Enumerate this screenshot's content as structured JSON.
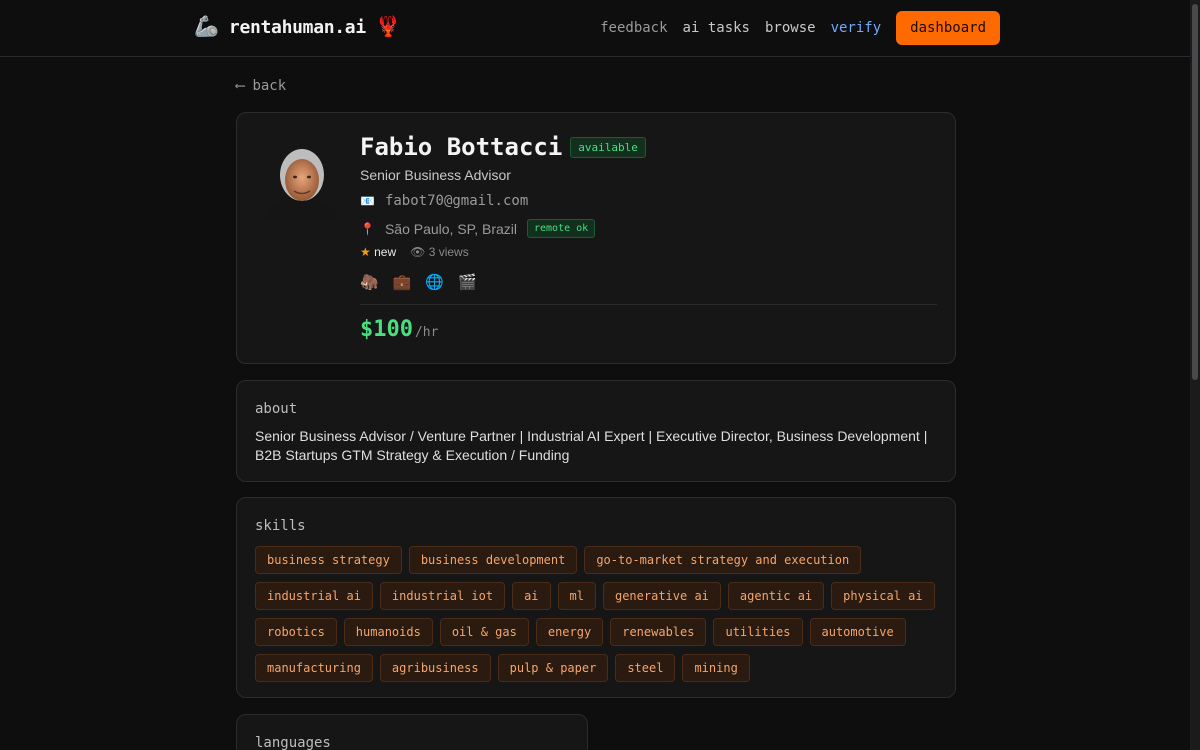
{
  "header": {
    "brand_emoji_left": "🦾",
    "brand_name": "rentahuman.ai",
    "brand_emoji_right": "🦞",
    "nav": [
      {
        "label": "feedback"
      },
      {
        "label": "ai tasks"
      },
      {
        "label": "browse"
      },
      {
        "label": "verify"
      }
    ],
    "dashboard_label": "dashboard"
  },
  "back_label": "back",
  "profile": {
    "name": "Fabio Bottacci",
    "status": "available",
    "headline": "Senior Business Advisor",
    "email": "fabot70@gmail.com",
    "location": "São Paulo, SP, Brazil",
    "remote_badge": "remote ok",
    "rating_label": "new",
    "views": "3 views",
    "social_icons": [
      "🦣",
      "💼",
      "🌐",
      "🎬"
    ],
    "rate_amount": "$100",
    "rate_unit": "/hr"
  },
  "about": {
    "title": "about",
    "text": "Senior Business Advisor / Venture Partner | Industrial AI Expert | Executive Director, Business Development | B2B Startups GTM Strategy & Execution / Funding"
  },
  "skills": {
    "title": "skills",
    "items": [
      "business strategy",
      "business development",
      "go-to-market strategy and execution",
      "industrial ai",
      "industrial iot",
      "ai",
      "ml",
      "generative ai",
      "agentic ai",
      "physical ai",
      "robotics",
      "humanoids",
      "oil & gas",
      "energy",
      "renewables",
      "utilities",
      "automotive",
      "manufacturing",
      "agribusiness",
      "pulp & paper",
      "steel",
      "mining"
    ]
  },
  "languages": {
    "title": "languages"
  },
  "colors": {
    "accent_orange": "#ff6a00",
    "available_green": "#4ade80",
    "verify_blue": "#6ea8ff",
    "chip_text": "#f5a56a"
  }
}
